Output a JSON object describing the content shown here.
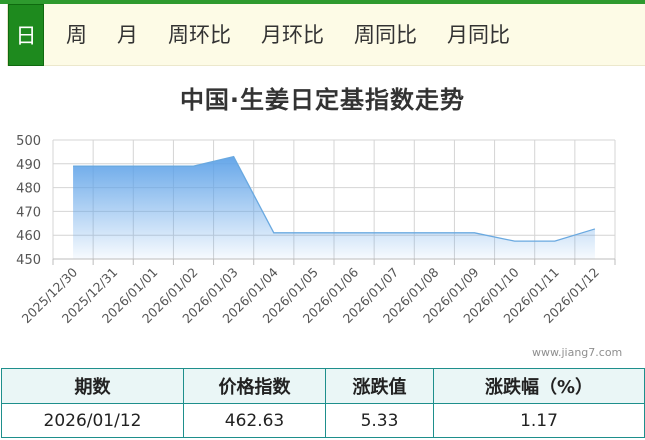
{
  "tabs": [
    {
      "label": "日",
      "active": true
    },
    {
      "label": "周",
      "active": false
    },
    {
      "label": "月",
      "active": false
    },
    {
      "label": "周环比",
      "active": false
    },
    {
      "label": "月环比",
      "active": false
    },
    {
      "label": "周同比",
      "active": false
    },
    {
      "label": "月同比",
      "active": false
    }
  ],
  "watermark": "www.jiang7.com",
  "colors": {
    "accent_green": "#1e8a1e",
    "line": "#6aa9e0",
    "area_top": "#5ea2e8",
    "table_border": "#1e8f8c"
  },
  "chart_data": {
    "type": "area",
    "title": "中国·生姜日定基指数走势",
    "x": [
      "2025/12/30",
      "2025/12/31",
      "2026/01/01",
      "2026/01/02",
      "2026/01/03",
      "2026/01/04",
      "2026/01/05",
      "2026/01/06",
      "2026/01/07",
      "2026/01/08",
      "2026/01/09",
      "2026/01/10",
      "2026/01/11",
      "2026/01/12"
    ],
    "series": [
      {
        "values": [
          489,
          489,
          489,
          489,
          493,
          461,
          461,
          461,
          461,
          461,
          461,
          457.5,
          457.5,
          462.63
        ]
      }
    ],
    "ylim": [
      450,
      500
    ],
    "yticks": [
      450,
      460,
      470,
      480,
      490,
      500
    ],
    "grid": true,
    "legend": "none"
  },
  "table": {
    "headers": [
      "期数",
      "价格指数",
      "涨跌值",
      "涨跌幅（%）"
    ],
    "rows": [
      [
        "2026/01/12",
        "462.63",
        "5.33",
        "1.17"
      ]
    ]
  }
}
